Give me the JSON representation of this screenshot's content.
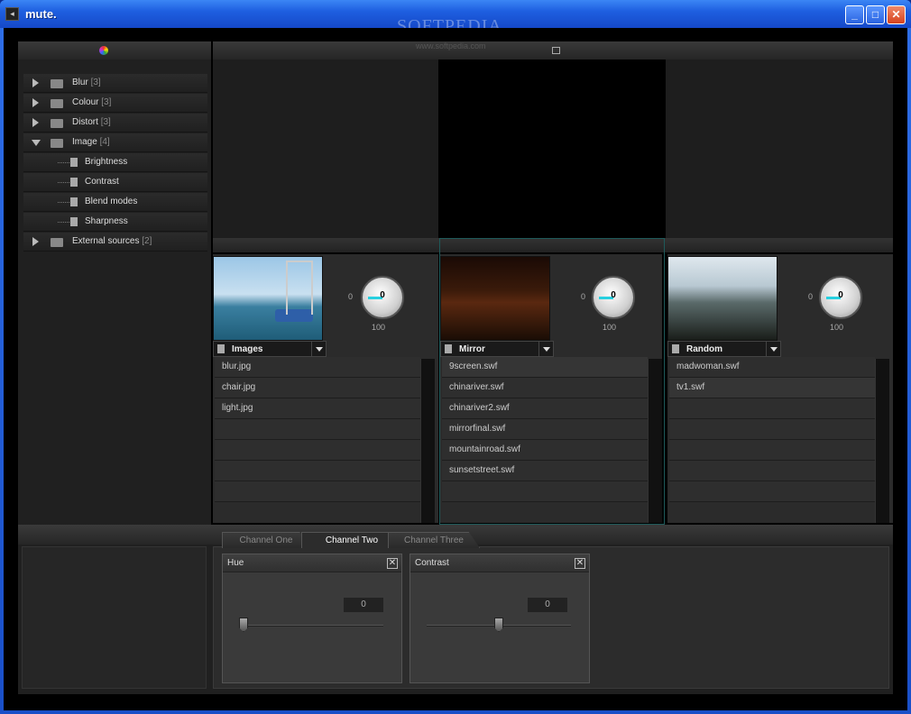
{
  "window": {
    "title": "mute.",
    "watermark": "SOFTPEDIA",
    "watermark_url": "www.softpedia.com"
  },
  "sidebar": {
    "items": [
      {
        "label": "Blur",
        "count": "[3]",
        "expanded": false
      },
      {
        "label": "Colour",
        "count": "[3]",
        "expanded": false
      },
      {
        "label": "Distort",
        "count": "[3]",
        "expanded": false
      },
      {
        "label": "Image",
        "count": "[4]",
        "expanded": true,
        "children": [
          "Brightness",
          "Contrast",
          "Blend modes",
          "Sharpness"
        ]
      },
      {
        "label": "External sources",
        "count": "[2]",
        "expanded": false
      }
    ]
  },
  "channels": [
    {
      "source": "Images",
      "knob_value": "0",
      "knob_min": "0",
      "knob_max": "100",
      "files": [
        "blur.jpg",
        "chair.jpg",
        "light.jpg"
      ]
    },
    {
      "source": "Mirror",
      "knob_value": "0",
      "knob_min": "0",
      "knob_max": "100",
      "files": [
        "9screen.swf",
        "chinariver.swf",
        "chinariver2.swf",
        "mirrorfinal.swf",
        "mountainroad.swf",
        "sunsetstreet.swf"
      ]
    },
    {
      "source": "Random",
      "knob_value": "0",
      "knob_min": "0",
      "knob_max": "100",
      "files": [
        "madwoman.swf",
        "tv1.swf"
      ]
    }
  ],
  "tabs": [
    "Channel One",
    "Channel Two",
    "Channel Three"
  ],
  "active_tab": "Channel Two",
  "effects": [
    {
      "name": "Hue",
      "value": "0",
      "level": 0
    },
    {
      "name": "Contrast",
      "value": "0",
      "level": 0.5
    }
  ],
  "colors": {
    "accent": "#27d0e0",
    "selected_border": "#1e5a5a"
  }
}
